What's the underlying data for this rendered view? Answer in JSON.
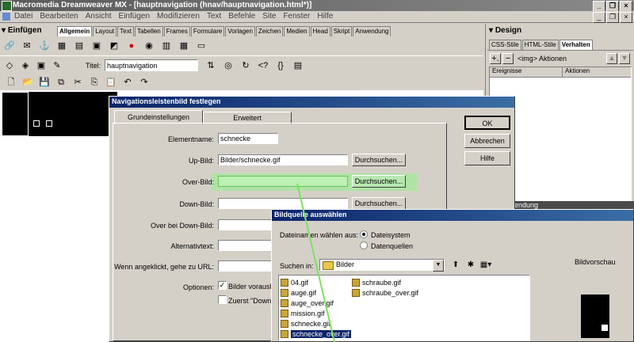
{
  "app": {
    "title": "Macromedia Dreamweaver MX - [hauptnavigation (hnav/hauptnavigation.html*)]",
    "menu": [
      "Datei",
      "Bearbeiten",
      "Ansicht",
      "Einfügen",
      "Modifizieren",
      "Text",
      "Befehle",
      "Site",
      "Fenster",
      "Hilfe"
    ],
    "insert_panel_title": "Einfügen",
    "insert_tabs": [
      "Allgemein",
      "Layout",
      "Text",
      "Tabellen",
      "Frames",
      "Formulare",
      "Vorlagen",
      "Zeichen",
      "Medien",
      "Head",
      "Skript",
      "Anwendung"
    ],
    "doc_title_label": "Titel:",
    "doc_title_value": "hauptnavigation"
  },
  "design_panel": {
    "title": "Design",
    "tabs": [
      "CSS-Stile",
      "HTML-Stile",
      "Verhalten"
    ],
    "behavior_target": "<img> Aktionen",
    "columns": [
      "Ereignisse",
      "Aktionen"
    ],
    "lower_fragment": "endung"
  },
  "nav_dialog": {
    "title": "Navigationsleistenbild festlegen",
    "tabs": [
      "Grundeinstellungen",
      "Erweitert"
    ],
    "fields": {
      "element_name_label": "Elementname:",
      "element_name_value": "schnecke",
      "up_label": "Up-Bild:",
      "up_value": "Bilder/schnecke.gif",
      "over_label": "Over-Bild:",
      "over_value": "",
      "down_label": "Down-Bild:",
      "down_value": "",
      "over_down_label": "Over bei Down-Bild:",
      "alt_label": "Alternativtext:",
      "url_label": "Wenn angeklickt, gehe zu URL:",
      "options_label": "Optionen:",
      "opt1": "Bilder vorausla",
      "opt2": "Zuerst \"Down-"
    },
    "browse": "Durchsuchen...",
    "ok": "OK",
    "cancel": "Abbrechen",
    "help": "Hilfe"
  },
  "file_dialog": {
    "title": "Bildquelle auswählen",
    "filename_from": "Dateinamen wählen aus:",
    "radio_fs": "Dateisystem",
    "radio_ds": "Datenquellen",
    "search_in": "Suchen in:",
    "folder": "Bilder",
    "preview": "Bildvorschau",
    "files_col1": [
      "04.gif",
      "auge.gif",
      "auge_over.gif",
      "mission.gif",
      "schnecke.gif",
      "schnecke_over.gif"
    ],
    "files_col2": [
      "schraube.gif",
      "schraube_over.gif"
    ]
  }
}
